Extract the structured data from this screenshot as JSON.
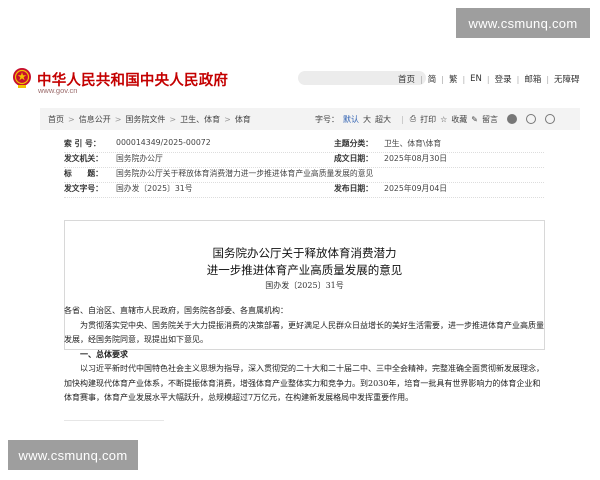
{
  "watermark": {
    "top": "www.csmunq.com",
    "bottom": "www.csmunq.com"
  },
  "header": {
    "site_title": "中华人民共和国中央人民政府",
    "site_url": "www.gov.cn",
    "links": [
      "首页",
      "简",
      "繁",
      "EN",
      "登录",
      "邮箱",
      "无障碍"
    ]
  },
  "breadcrumb": {
    "items": [
      "首页",
      "信息公开",
      "国务院文件",
      "卫生、体育",
      "体育"
    ],
    "tools": {
      "font_label": "字号：",
      "font_default": "默认",
      "font_large": "大",
      "font_huge": "超大",
      "print": "打印",
      "favorite": "收藏",
      "comment": "留言"
    },
    "colors": {
      "accent_blue": "#2a5db0",
      "brand_red": "#c40000"
    }
  },
  "meta": {
    "index_label": "索 引 号：",
    "index_value": "000014349/2025-00072",
    "category_label": "主题分类：",
    "category_value": "卫生、体育\\体育",
    "issuer_label": "发文机关：",
    "issuer_value": "国务院办公厅",
    "date_label": "成文日期：",
    "date_value": "2025年08月30日",
    "title_label": "标　　题：",
    "title_value": "国务院办公厅关于释放体育消费潜力进一步推进体育产业高质量发展的意见",
    "docno_label": "发文字号：",
    "docno_value": "国办发〔2025〕31号",
    "pubdate_label": "发布日期：",
    "pubdate_value": "2025年09月04日"
  },
  "document": {
    "title_line1": "国务院办公厅关于释放体育消费潜力",
    "title_line2": "进一步推进体育产业高质量发展的意见",
    "number": "国办发〔2025〕31号"
  },
  "body": {
    "salutation": "各省、自治区、直辖市人民政府，国务院各部委、各直属机构：",
    "para1": "为贯彻落实党中央、国务院关于大力提振消费的决策部署，更好满足人民群众日益增长的美好生活需要，进一步推进体育产业高质量发展，经国务院同意，现提出如下意见。",
    "section1": "一、总体要求",
    "para2": "以习近平新时代中国特色社会主义思想为指导，深入贯彻党的二十大和二十届二中、三中全会精神，完整准确全面贯彻新发展理念，加快构建现代体育产业体系，不断提振体育消费，增强体育产业整体实力和竞争力。到2030年，培育一批具有世界影响力的体育企业和体育赛事，体育产业发展水平大幅跃升，总规模超过7万亿元，在构建新发展格局中发挥重要作用。"
  }
}
